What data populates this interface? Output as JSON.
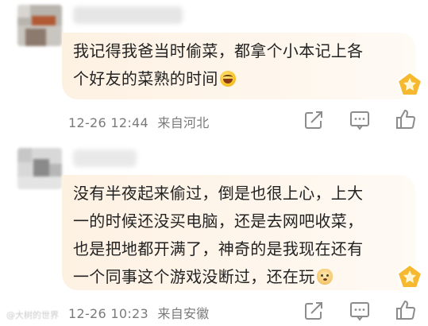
{
  "comments": [
    {
      "text": "我记得我爸当时偷菜，都拿个小本记上各个好友的菜熟的时间",
      "emoji": "laughing-tears-emoji",
      "date": "12-26 12:44",
      "location": "来自河北"
    },
    {
      "text": "没有半夜起来偷过，倒是也很上心，上大一的时候还没买电脑，还是去网吧收菜，也是把地都开满了，神奇的是我现在还有一个同事这个游戏没断过，还在玩",
      "emoji": "dog-face-emoji",
      "date": "12-26 10:23",
      "location": "来自安徽"
    }
  ],
  "icons": {
    "share": "share-icon",
    "comment": "comment-icon",
    "like": "thumbs-up-icon",
    "badge": "star-pentagon-badge-icon"
  },
  "colors": {
    "bubble": "#fdf1e2",
    "meta_text": "#7a7a7a",
    "badge_gold": "#f5b82e"
  },
  "watermark": "@大树的世界"
}
